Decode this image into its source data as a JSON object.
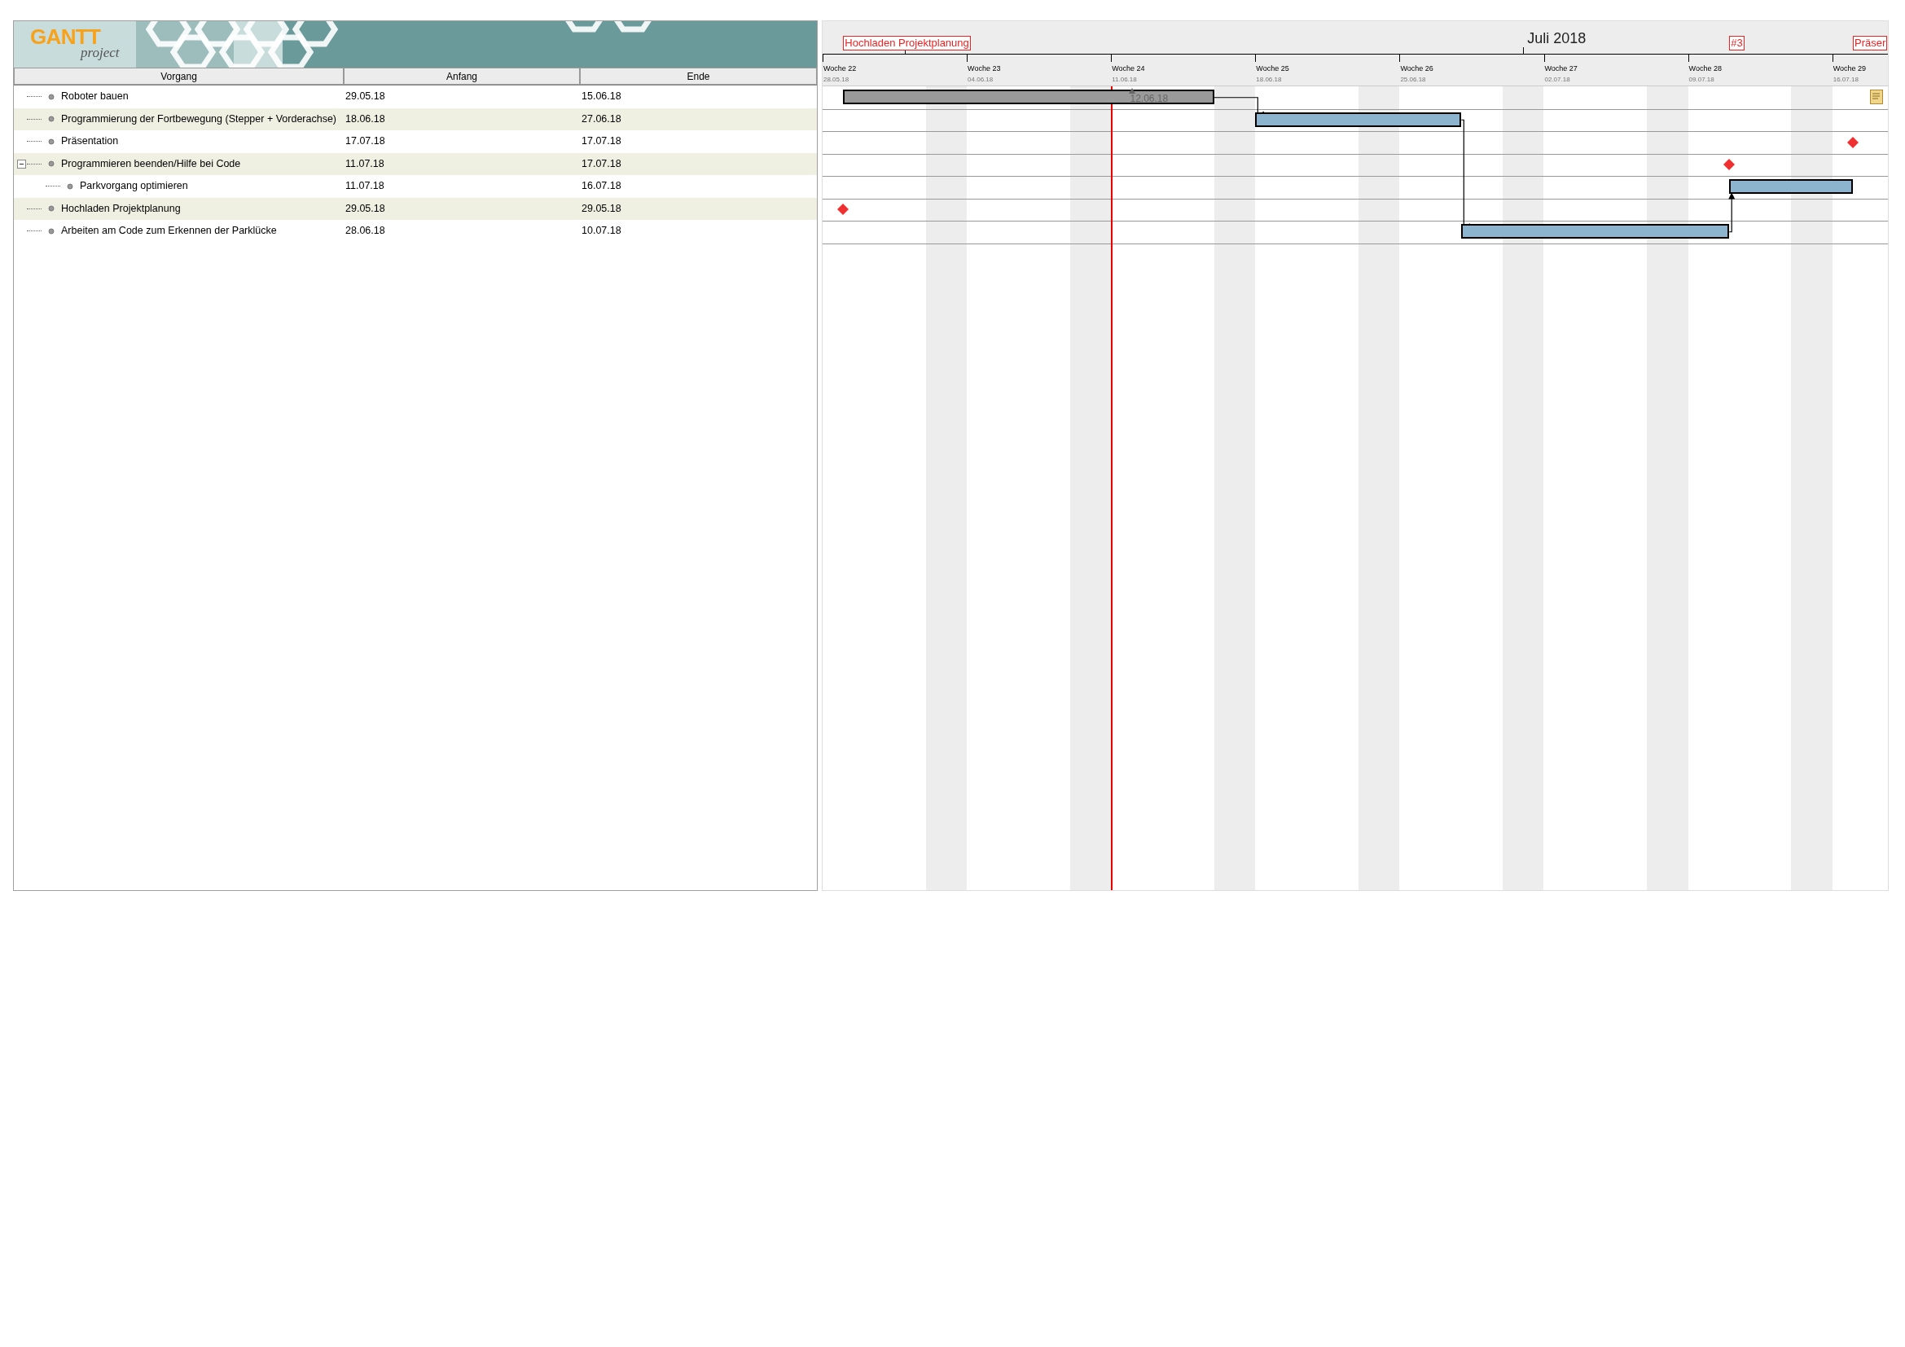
{
  "logo": {
    "word": "GANTT",
    "subword": "project"
  },
  "table": {
    "columns": [
      "Vorgang",
      "Anfang",
      "Ende"
    ],
    "tasks": [
      {
        "name": "Roboter bauen",
        "start": "29.05.18",
        "end": "15.06.18",
        "kind": "task",
        "color": "#9a9a9a",
        "progress_label": "12.06.18",
        "note": true
      },
      {
        "name": "Programmierung der Fortbewegung (Stepper + Vorderachse)",
        "start": "18.06.18",
        "end": "27.06.18",
        "kind": "task",
        "color": "#8db4cf",
        "has_predecessor": true
      },
      {
        "name": "Präsentation",
        "start": "17.07.18",
        "end": "17.07.18",
        "kind": "milestone",
        "labeled": true
      },
      {
        "name": "Programmieren beenden/Hilfe bei Code",
        "start": "11.07.18",
        "end": "17.07.18",
        "kind": "summary",
        "expanded": true,
        "labeled": true,
        "children": [
          {
            "name": "Parkvorgang optimieren",
            "start": "11.07.18",
            "end": "16.07.18",
            "kind": "task",
            "color": "#8db4cf",
            "has_predecessor": true
          }
        ]
      },
      {
        "name": "Hochladen Projektplanung",
        "start": "29.05.18",
        "end": "29.05.18",
        "kind": "milestone",
        "labeled": true
      },
      {
        "name": "Arbeiten am Code zum Erkennen der Parklücke",
        "start": "28.06.18",
        "end": "10.07.18",
        "kind": "task",
        "color": "#8db4cf",
        "has_predecessor": true
      }
    ]
  },
  "timeline": {
    "labels": [
      "Hochladen Projektplanung",
      "#3",
      "Präser"
    ],
    "months": [
      "Juli 2018"
    ],
    "weeks": [
      {
        "label": "Woche 22",
        "date": "28.05.18",
        "today": false
      },
      {
        "label": "Woche 23",
        "date": "04.06.18",
        "today": false
      },
      {
        "label": "Woche 24",
        "date": "11.06.18",
        "today": true
      },
      {
        "label": "Woche 25",
        "date": "18.06.18",
        "today": false
      },
      {
        "label": "Woche 26",
        "date": "25.06.18",
        "today": false
      },
      {
        "label": "Woche 27",
        "date": "02.07.18",
        "today": false
      },
      {
        "label": "Woche 28",
        "date": "09.07.18",
        "today": false
      },
      {
        "label": "Woche 29",
        "date": "16.07.18",
        "today": false
      }
    ]
  }
}
